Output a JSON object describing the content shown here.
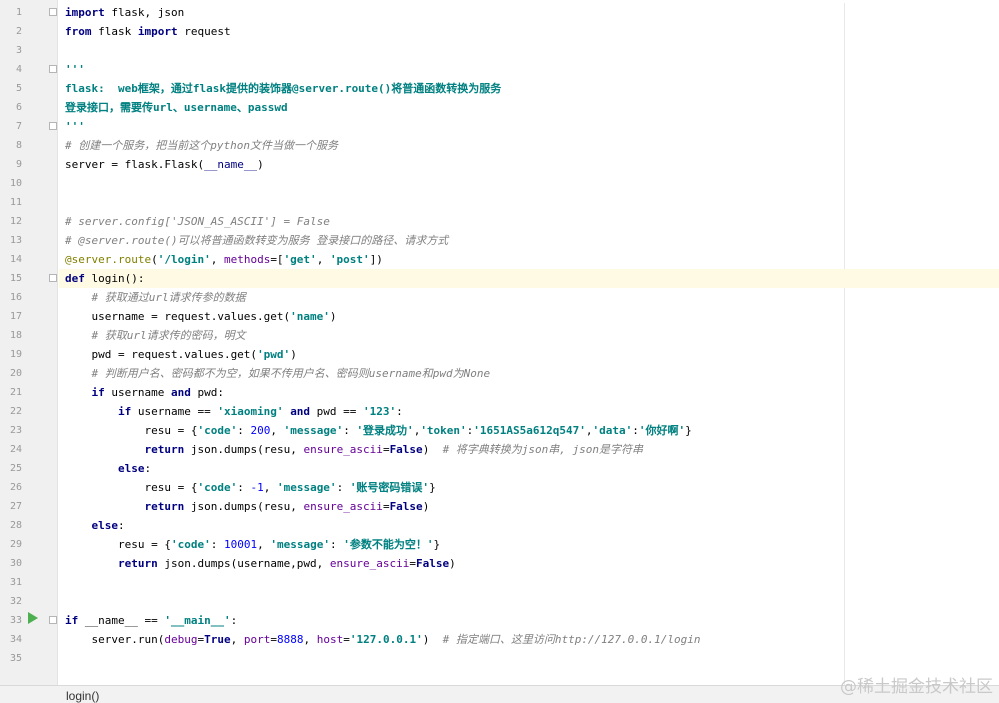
{
  "editor": {
    "language": "python",
    "current_line": 15,
    "run_marker_line": 33,
    "line_numbers": [
      "1",
      "2",
      "3",
      "4",
      "5",
      "6",
      "7",
      "8",
      "9",
      "10",
      "11",
      "12",
      "13",
      "14",
      "15",
      "16",
      "17",
      "18",
      "19",
      "20",
      "21",
      "22",
      "23",
      "24",
      "25",
      "26",
      "27",
      "28",
      "29",
      "30",
      "31",
      "32",
      "33",
      "34",
      "35"
    ],
    "lines": [
      [
        {
          "t": "kw",
          "v": "import"
        },
        {
          "t": "",
          "v": " flask, json"
        }
      ],
      [
        {
          "t": "kw",
          "v": "from"
        },
        {
          "t": "",
          "v": " flask "
        },
        {
          "t": "kw",
          "v": "import"
        },
        {
          "t": "",
          "v": " request"
        }
      ],
      [],
      [
        {
          "t": "doc",
          "v": "'''"
        }
      ],
      [
        {
          "t": "doc",
          "v": "flask:  web框架，通过flask提供的装饰器@server.route()将普通函数转换为服务"
        }
      ],
      [
        {
          "t": "doc",
          "v": "登录接口，需要传url、username、passwd"
        }
      ],
      [
        {
          "t": "doc",
          "v": "'''"
        }
      ],
      [
        {
          "t": "cmt",
          "v": "# 创建一个服务，把当前这个python文件当做一个服务"
        }
      ],
      [
        {
          "t": "",
          "v": "server = flask.Flask("
        },
        {
          "t": "bi",
          "v": "__name__"
        },
        {
          "t": "",
          "v": ")"
        }
      ],
      [],
      [],
      [
        {
          "t": "cmt",
          "v": "# server.config['JSON_AS_ASCII'] = False"
        }
      ],
      [
        {
          "t": "cmt",
          "v": "# @server.route()可以将普通函数转变为服务 登录接口的路径、请求方式"
        }
      ],
      [
        {
          "t": "dec",
          "v": "@server.route"
        },
        {
          "t": "",
          "v": "("
        },
        {
          "t": "str",
          "v": "'/login'"
        },
        {
          "t": "",
          "v": ", "
        },
        {
          "t": "kwarg",
          "v": "methods"
        },
        {
          "t": "",
          "v": "=["
        },
        {
          "t": "str",
          "v": "'get'"
        },
        {
          "t": "",
          "v": ", "
        },
        {
          "t": "str",
          "v": "'post'"
        },
        {
          "t": "",
          "v": "])"
        }
      ],
      [
        {
          "t": "kw",
          "v": "def"
        },
        {
          "t": "",
          "v": " login():"
        }
      ],
      [
        {
          "t": "",
          "v": "    "
        },
        {
          "t": "cmt",
          "v": "# 获取通过url请求传参的数据"
        }
      ],
      [
        {
          "t": "",
          "v": "    username = request.values.get("
        },
        {
          "t": "str",
          "v": "'name'"
        },
        {
          "t": "",
          "v": ")"
        }
      ],
      [
        {
          "t": "",
          "v": "    "
        },
        {
          "t": "cmt",
          "v": "# 获取url请求传的密码，明文"
        }
      ],
      [
        {
          "t": "",
          "v": "    pwd = request.values.get("
        },
        {
          "t": "str",
          "v": "'pwd'"
        },
        {
          "t": "",
          "v": ")"
        }
      ],
      [
        {
          "t": "",
          "v": "    "
        },
        {
          "t": "cmt",
          "v": "# 判断用户名、密码都不为空，如果不传用户名、密码则username和pwd为None"
        }
      ],
      [
        {
          "t": "",
          "v": "    "
        },
        {
          "t": "kw",
          "v": "if"
        },
        {
          "t": "",
          "v": " username "
        },
        {
          "t": "kw",
          "v": "and"
        },
        {
          "t": "",
          "v": " pwd:"
        }
      ],
      [
        {
          "t": "",
          "v": "        "
        },
        {
          "t": "kw",
          "v": "if"
        },
        {
          "t": "",
          "v": " username == "
        },
        {
          "t": "str",
          "v": "'xiaoming'"
        },
        {
          "t": "",
          "v": " "
        },
        {
          "t": "kw",
          "v": "and"
        },
        {
          "t": "",
          "v": " pwd == "
        },
        {
          "t": "str",
          "v": "'123'"
        },
        {
          "t": "",
          "v": ":"
        }
      ],
      [
        {
          "t": "",
          "v": "            resu = {"
        },
        {
          "t": "str",
          "v": "'code'"
        },
        {
          "t": "",
          "v": ": "
        },
        {
          "t": "num",
          "v": "200"
        },
        {
          "t": "",
          "v": ", "
        },
        {
          "t": "str",
          "v": "'message'"
        },
        {
          "t": "",
          "v": ": "
        },
        {
          "t": "str",
          "v": "'登录成功'"
        },
        {
          "t": "",
          "v": ","
        },
        {
          "t": "str",
          "v": "'token'"
        },
        {
          "t": "",
          "v": ":"
        },
        {
          "t": "str",
          "v": "'1651AS5a612q547'"
        },
        {
          "t": "",
          "v": ","
        },
        {
          "t": "str",
          "v": "'data'"
        },
        {
          "t": "",
          "v": ":"
        },
        {
          "t": "str",
          "v": "'你好啊'"
        },
        {
          "t": "",
          "v": "}"
        }
      ],
      [
        {
          "t": "",
          "v": "            "
        },
        {
          "t": "kw",
          "v": "return"
        },
        {
          "t": "",
          "v": " json.dumps(resu, "
        },
        {
          "t": "kwarg",
          "v": "ensure_ascii"
        },
        {
          "t": "",
          "v": "="
        },
        {
          "t": "kw",
          "v": "False"
        },
        {
          "t": "",
          "v": ")  "
        },
        {
          "t": "cmt",
          "v": "# 将字典转换为json串, json是字符串"
        }
      ],
      [
        {
          "t": "",
          "v": "        "
        },
        {
          "t": "kw",
          "v": "else"
        },
        {
          "t": "",
          "v": ":"
        }
      ],
      [
        {
          "t": "",
          "v": "            resu = {"
        },
        {
          "t": "str",
          "v": "'code'"
        },
        {
          "t": "",
          "v": ": "
        },
        {
          "t": "num",
          "v": "-1"
        },
        {
          "t": "",
          "v": ", "
        },
        {
          "t": "str",
          "v": "'message'"
        },
        {
          "t": "",
          "v": ": "
        },
        {
          "t": "str",
          "v": "'账号密码错误'"
        },
        {
          "t": "",
          "v": "}"
        }
      ],
      [
        {
          "t": "",
          "v": "            "
        },
        {
          "t": "kw",
          "v": "return"
        },
        {
          "t": "",
          "v": " json.dumps(resu, "
        },
        {
          "t": "kwarg",
          "v": "ensure_ascii"
        },
        {
          "t": "",
          "v": "="
        },
        {
          "t": "kw",
          "v": "False"
        },
        {
          "t": "",
          "v": ")"
        }
      ],
      [
        {
          "t": "",
          "v": "    "
        },
        {
          "t": "kw",
          "v": "else"
        },
        {
          "t": "",
          "v": ":"
        }
      ],
      [
        {
          "t": "",
          "v": "        resu = {"
        },
        {
          "t": "str",
          "v": "'code'"
        },
        {
          "t": "",
          "v": ": "
        },
        {
          "t": "num",
          "v": "10001"
        },
        {
          "t": "",
          "v": ", "
        },
        {
          "t": "str",
          "v": "'message'"
        },
        {
          "t": "",
          "v": ": "
        },
        {
          "t": "str",
          "v": "'参数不能为空！'"
        },
        {
          "t": "",
          "v": "}"
        }
      ],
      [
        {
          "t": "",
          "v": "        "
        },
        {
          "t": "kw",
          "v": "return"
        },
        {
          "t": "",
          "v": " json.dumps(username,pwd, "
        },
        {
          "t": "kwarg",
          "v": "ensure_ascii"
        },
        {
          "t": "",
          "v": "="
        },
        {
          "t": "kw",
          "v": "False"
        },
        {
          "t": "",
          "v": ")"
        }
      ],
      [],
      [],
      [
        {
          "t": "kw",
          "v": "if"
        },
        {
          "t": "",
          "v": " __name__ == "
        },
        {
          "t": "str",
          "v": "'__main__'"
        },
        {
          "t": "",
          "v": ":"
        }
      ],
      [
        {
          "t": "",
          "v": "    server.run("
        },
        {
          "t": "kwarg",
          "v": "debug"
        },
        {
          "t": "",
          "v": "="
        },
        {
          "t": "kw",
          "v": "True"
        },
        {
          "t": "",
          "v": ", "
        },
        {
          "t": "kwarg",
          "v": "port"
        },
        {
          "t": "",
          "v": "="
        },
        {
          "t": "num",
          "v": "8888"
        },
        {
          "t": "",
          "v": ", "
        },
        {
          "t": "kwarg",
          "v": "host"
        },
        {
          "t": "",
          "v": "="
        },
        {
          "t": "str",
          "v": "'127.0.0.1'"
        },
        {
          "t": "",
          "v": ")  "
        },
        {
          "t": "cmt",
          "v": "# 指定端口、这里访问http://127.0.0.1/login"
        }
      ],
      []
    ]
  },
  "status_bar": {
    "breadcrumb": "login()"
  },
  "watermark": "@稀土掘金技术社区",
  "icons": {
    "run": "run-icon",
    "fold": "fold-marker-icon"
  },
  "colors": {
    "keyword": "#000080",
    "string": "#008080",
    "comment": "#808080",
    "number": "#0000ff",
    "decorator": "#808000",
    "current_line": "#fffae3"
  }
}
